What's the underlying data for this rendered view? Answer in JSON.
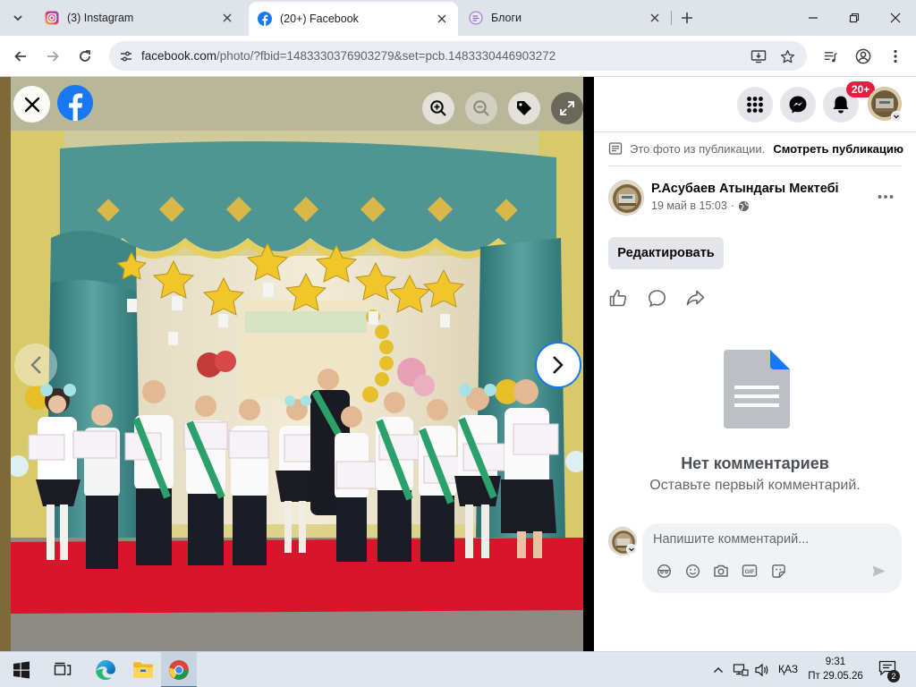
{
  "browser": {
    "tabs": [
      {
        "title": "(3) Instagram",
        "icon": "instagram-icon"
      },
      {
        "title": "(20+) Facebook",
        "icon": "facebook-icon",
        "active": true
      },
      {
        "title": "Блоги",
        "icon": "blogger-icon"
      }
    ],
    "url_host": "facebook.com",
    "url_path": "/photo/?fbid=1483330376903279&set=pcb.1483330446903272"
  },
  "viewer": {
    "photo_alt": "Graduation ceremony photo: children holding certificates on a stage with teal curtains and gold star balloons"
  },
  "header": {
    "notifications_badge": "20+"
  },
  "post": {
    "notice_text": "Это фото из публикации.",
    "notice_link": "Смотреть публикацию",
    "author": "Р.Асубаев Атындағы Мектебі",
    "date": "19 май в 15:03",
    "date_separator": "·",
    "edit_label": "Редактировать",
    "empty_title": "Нет комментариев",
    "empty_subtitle": "Оставьте первый комментарий.",
    "comment_placeholder": "Напишите комментарий..."
  },
  "taskbar": {
    "language": "ҚАЗ",
    "time": "9:31",
    "date": "Пт 29.05.26",
    "notification_count": "2"
  },
  "colors": {
    "facebook_blue": "#1877f2",
    "badge_red": "#e41e3f",
    "panel_bg": "#ffffff",
    "viewer_bg": "#000000"
  }
}
